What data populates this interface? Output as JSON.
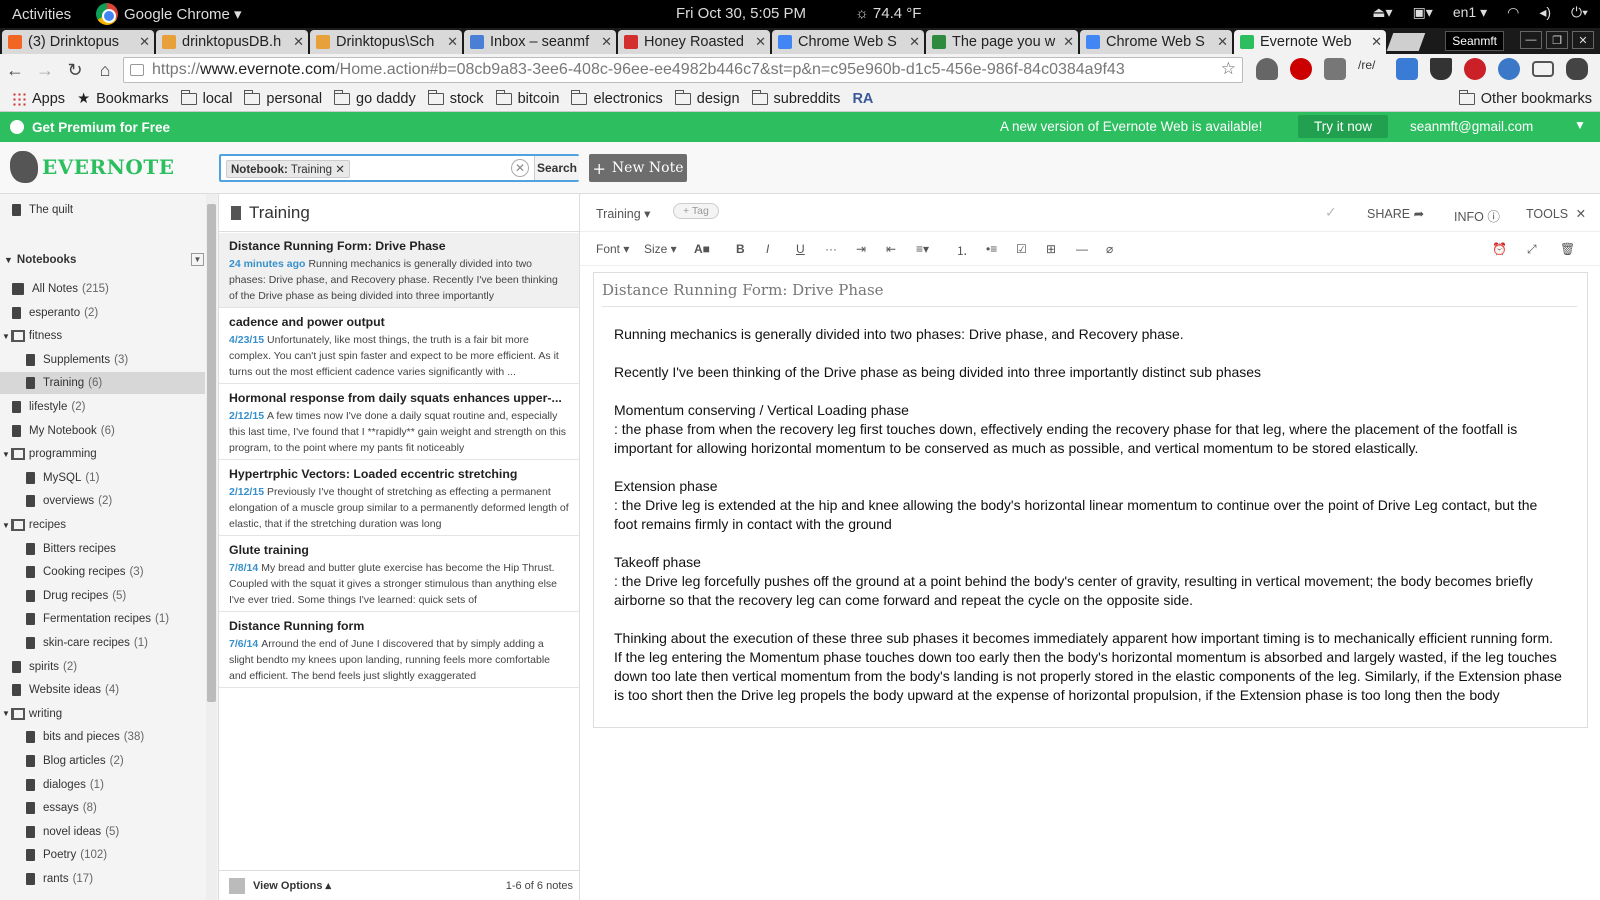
{
  "os": {
    "activities": "Activities",
    "app": "Google Chrome ▾",
    "clock": "Fri Oct 30,  5:05 PM",
    "weather": "☼ 74.4 °F",
    "locale": "en1 ▾"
  },
  "tabs": [
    {
      "title": "(3) Drinktopus",
      "color": "#f26522"
    },
    {
      "title": "drinktopusDB.h",
      "color": "#e8a03a"
    },
    {
      "title": "Drinktopus\\Sch",
      "color": "#e8a03a"
    },
    {
      "title": "Inbox – seanmf",
      "color": "#4a7fd6"
    },
    {
      "title": "Honey Roasted",
      "color": "#d32f2f"
    },
    {
      "title": "Chrome Web S",
      "color": "#4285f4"
    },
    {
      "title": "The page you w",
      "color": "#2e8b3e"
    },
    {
      "title": "Chrome Web S",
      "color": "#4285f4"
    },
    {
      "title": "Evernote Web",
      "color": "#2dbe60"
    }
  ],
  "profile": "Seanmft",
  "address": {
    "prefix": "https://",
    "domain": "www.evernote.com",
    "path": "/Home.action#b=08cb9a83-3ee6-408c-96ee-ee4982b446c7&st=p&n=c95e960b-d1c5-456e-986f-84c0384a9f43"
  },
  "bookmarks": [
    "Apps",
    "Bookmarks",
    "local",
    "personal",
    "go daddy",
    "stock",
    "bitcoin",
    "electronics",
    "design",
    "subreddits",
    "RA",
    "Other bookmarks"
  ],
  "banner": {
    "premium": "Get Premium for Free",
    "message": "A new version of Evernote Web is available!",
    "try": "Try it now",
    "email": "seanmft@gmail.com"
  },
  "header": {
    "logo": "EVERNOTE",
    "chip_label": "Notebook:",
    "chip_value": "Training",
    "search": "Search",
    "new_note": "New Note"
  },
  "sidebar": {
    "top_item": "The quilt",
    "notebooks_label": "Notebooks",
    "items": [
      {
        "label": "All Notes",
        "count": "(215)",
        "type": "all"
      },
      {
        "label": "esperanto",
        "count": "(2)",
        "type": "nb"
      },
      {
        "label": "fitness",
        "count": "",
        "type": "stack"
      },
      {
        "label": "Supplements",
        "count": "(3)",
        "type": "sub"
      },
      {
        "label": "Training",
        "count": "(6)",
        "type": "sub"
      },
      {
        "label": "lifestyle",
        "count": "(2)",
        "type": "nb"
      },
      {
        "label": "My Notebook",
        "count": "(6)",
        "type": "nb"
      },
      {
        "label": "programming",
        "count": "",
        "type": "stack"
      },
      {
        "label": "MySQL",
        "count": "(1)",
        "type": "sub"
      },
      {
        "label": "overviews",
        "count": "(2)",
        "type": "sub"
      },
      {
        "label": "recipes",
        "count": "",
        "type": "stack"
      },
      {
        "label": "Bitters recipes",
        "count": "",
        "type": "sub"
      },
      {
        "label": "Cooking recipes",
        "count": "(3)",
        "type": "sub"
      },
      {
        "label": "Drug recipes",
        "count": "(5)",
        "type": "sub"
      },
      {
        "label": "Fermentation recipes",
        "count": "(1)",
        "type": "sub"
      },
      {
        "label": "skin-care recipes",
        "count": "(1)",
        "type": "sub"
      },
      {
        "label": "spirits",
        "count": "(2)",
        "type": "nb"
      },
      {
        "label": "Website ideas",
        "count": "(4)",
        "type": "nb"
      },
      {
        "label": "writing",
        "count": "",
        "type": "stack"
      },
      {
        "label": "bits and pieces",
        "count": "(38)",
        "type": "sub"
      },
      {
        "label": "Blog articles",
        "count": "(2)",
        "type": "sub"
      },
      {
        "label": "dialoges",
        "count": "(1)",
        "type": "sub"
      },
      {
        "label": "essays",
        "count": "(8)",
        "type": "sub"
      },
      {
        "label": "novel ideas",
        "count": "(5)",
        "type": "sub"
      },
      {
        "label": "Poetry",
        "count": "(102)",
        "type": "sub"
      },
      {
        "label": "rants",
        "count": "(17)",
        "type": "sub"
      }
    ]
  },
  "notelist": {
    "title": "Training",
    "notes": [
      {
        "title": "Distance Running Form: Drive Phase",
        "date": "24 minutes ago",
        "snippet": "Running mechanics is generally divided into two phases: Drive phase, and Recovery phase.  Recently I've been thinking of the Drive phase as being divided into three importantly"
      },
      {
        "title": "cadence and power output",
        "date": "4/23/15",
        "snippet": "Unfortunately, like most things, the truth is a fair bit more complex. You can't just spin faster and expect to be more efficient. As it turns out the most efficient cadence varies significantly with ..."
      },
      {
        "title": "Hormonal response from daily squats enhances upper-...",
        "date": "2/12/15",
        "snippet": "A few times now I've done a daily squat routine and, especially this last time, I've found that I **rapidly** gain weight and strength on this program, to the point where my pants fit noticeably"
      },
      {
        "title": "Hypertrphic Vectors: Loaded eccentric stretching",
        "date": "2/12/15",
        "snippet": "Previously I've thought of stretching as effecting a permanent elongation of a muscle group similar to a permanently deformed length of elastic, that if the stretching duration was long"
      },
      {
        "title": "Glute training",
        "date": "7/8/14",
        "snippet": "My bread and butter glute exercise has become the Hip Thrust. Coupled with the squat it gives a stronger stimulous than anything else I've ever tried. Some things I've learned: quick sets of"
      },
      {
        "title": "Distance Running form",
        "date": "7/6/14",
        "snippet": "Arround the end of June I discovered that by simply adding a slight bendto my knees upon landing, running feels more comfortable and efficient. The bend feels just slightly exaggerated"
      }
    ],
    "view_options": "View Options ▴",
    "count": "1-6 of 6 notes"
  },
  "editor": {
    "notebook": "Training",
    "tag": "+ Tag",
    "share": "SHARE",
    "info": "INFO",
    "tools": "TOOLS",
    "font": "Font",
    "size": "Size",
    "title": "Distance Running Form: Drive Phase",
    "body": [
      [
        "Running mechanics is generally divided into two phases: Drive phase, and Recovery phase."
      ],
      [
        "Recently I've been thinking of the Drive phase as being divided into three importantly distinct sub phases"
      ],
      [
        "Momentum conserving / Vertical Loading phase",
        " : the phase from when the recovery leg first touches down, effectively ending the recovery phase for that leg, where the placement of the footfall is important for allowing horizontal momentum to be conserved as much as possible, and vertical momentum to be stored elastically."
      ],
      [
        "Extension phase",
        " : the Drive leg is extended at the hip and knee allowing the body's horizontal linear momentum to continue over the point of Drive Leg contact, but the foot remains firmly in contact with the ground"
      ],
      [
        "Takeoff phase",
        " : the Drive leg forcefully pushes off the ground at a point behind the body's center of gravity, resulting in vertical movement; the body becomes briefly airborne so that the recovery leg can come forward and repeat the cycle on the opposite side."
      ],
      [
        "Thinking about the execution of these three sub phases it becomes immediately apparent how important timing is to mechanically efficient running form. If the leg entering the Momentum phase touches down too early then the body's horizontal momentum is absorbed and largely wasted, if the leg touches down too late then vertical momentum from the body's landing is not properly stored in the elastic components of the leg. Similarly, if the Extension phase is too short then the Drive leg propels the body upward at the expense of horizontal propulsion, if the Extension phase is too long then the body"
      ]
    ]
  }
}
